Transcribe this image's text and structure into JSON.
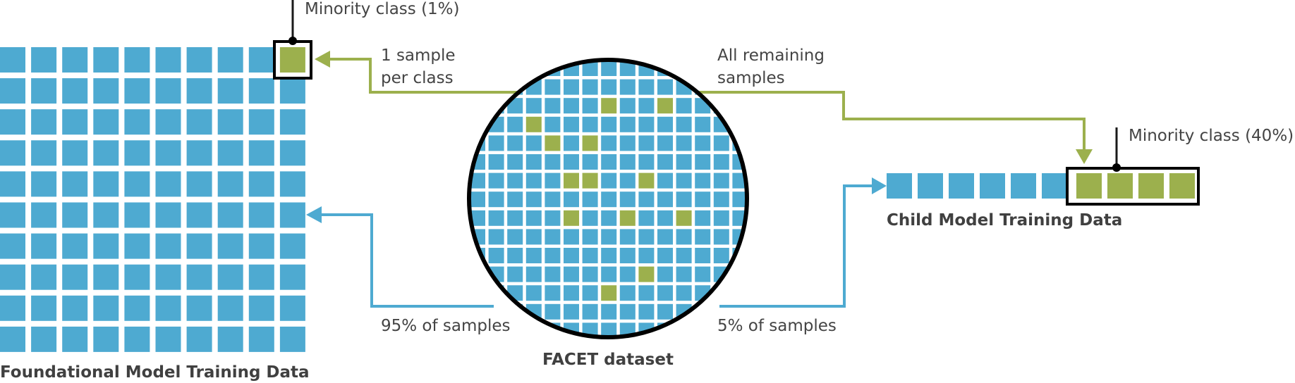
{
  "colors": {
    "majority": "#4eaad1",
    "minority": "#9cb04d",
    "outline": "#000000",
    "text": "#444444",
    "flow_green": "#9cb04d",
    "flow_blue": "#4eaad1"
  },
  "foundational": {
    "title": "Foundational Model Training Data",
    "grid_rows": 10,
    "grid_cols": 10,
    "minority_cells": [
      [
        0,
        9
      ]
    ],
    "minority_callout": "Minority class (1%)"
  },
  "facet": {
    "title": "FACET dataset",
    "grid_rows": 15,
    "grid_cols": 15,
    "minority_cells": [
      [
        2,
        7
      ],
      [
        2,
        10
      ],
      [
        3,
        3
      ],
      [
        4,
        4
      ],
      [
        4,
        6
      ],
      [
        6,
        5
      ],
      [
        6,
        6
      ],
      [
        6,
        9
      ],
      [
        8,
        5
      ],
      [
        8,
        8
      ],
      [
        8,
        11
      ],
      [
        11,
        9
      ],
      [
        12,
        7
      ]
    ]
  },
  "child": {
    "title": "Child Model Training Data",
    "total_cells": 10,
    "minority_count": 4,
    "minority_callout": "Minority class (40%)"
  },
  "flows": {
    "to_foundational_minority": [
      "1 sample",
      "per class"
    ],
    "to_child_minority": [
      "All remaining",
      "samples"
    ],
    "to_foundational_majority": "95% of samples",
    "to_child_majority": "5% of samples"
  }
}
